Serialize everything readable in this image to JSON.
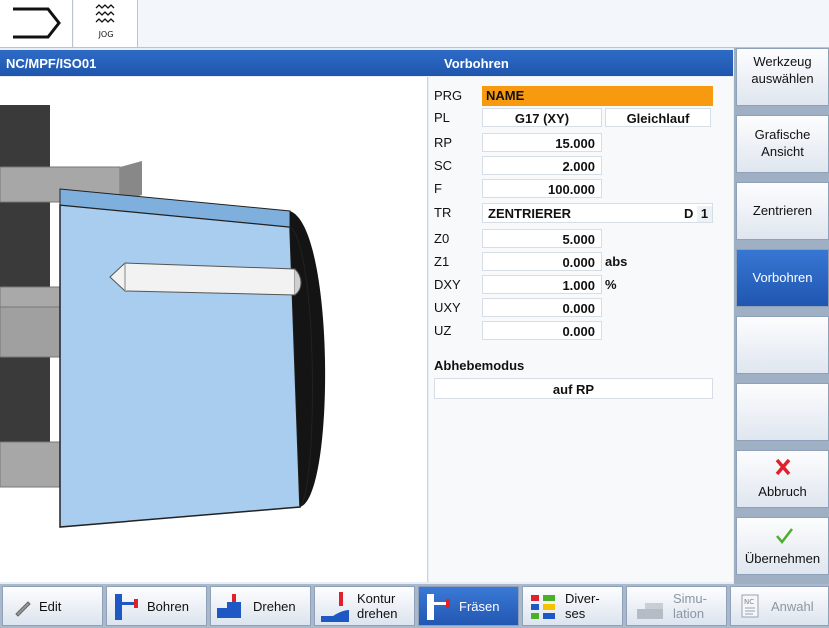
{
  "topbar": {
    "jog_label": "JOG"
  },
  "header": {
    "program_path": "NC/MPF/ISO01",
    "cycle_title": "Vorbohren"
  },
  "form": {
    "prg": {
      "label": "PRG",
      "value": "NAME"
    },
    "pl": {
      "label": "PL",
      "value": "G17 (XY)",
      "mode": "Gleichlauf"
    },
    "rp": {
      "label": "RP",
      "value": "15.000"
    },
    "sc": {
      "label": "SC",
      "value": "2.000"
    },
    "f": {
      "label": "F",
      "value": "100.000"
    },
    "tr": {
      "label": "TR",
      "tool": "ZENTRIERER",
      "d_label": "D",
      "d_value": "1"
    },
    "z0": {
      "label": "Z0",
      "value": "5.000"
    },
    "z1": {
      "label": "Z1",
      "value": "0.000",
      "unit": "abs"
    },
    "dxy": {
      "label": "DXY",
      "value": "1.000",
      "unit": "%"
    },
    "uxy": {
      "label": "UXY",
      "value": "0.000"
    },
    "uz": {
      "label": "UZ",
      "value": "0.000"
    },
    "lift": {
      "label": "Abhebemodus",
      "value": "auf RP"
    }
  },
  "softkeys_vertical": {
    "werkzeug": "Werkzeug auswählen",
    "werkzeug_l1": "Werkzeug",
    "werkzeug_l2": "auswählen",
    "grafische_l1": "Grafische",
    "grafische_l2": "Ansicht",
    "zentrieren": "Zentrieren",
    "vorbohren": "Vorbohren",
    "abbruch": "Abbruch",
    "uebernehmen": "Übernehmen"
  },
  "softkeys_horizontal": {
    "edit": "Edit",
    "bohren": "Bohren",
    "drehen": "Drehen",
    "kontur_l1": "Kontur",
    "kontur_l2": "drehen",
    "fraesen": "Fräsen",
    "diverses_l1": "Diver-",
    "diverses_l2": "ses",
    "simulation_l1": "Simu-",
    "simulation_l2": "lation",
    "anwahl": "Anwahl",
    "nc_badge": "NC"
  },
  "colors": {
    "header_blue": "#2060bc",
    "prg_highlight": "#f89a10",
    "accept_green": "#4caf28",
    "cancel_red": "#e0202a",
    "workpiece_blue": "#a8cdee"
  }
}
